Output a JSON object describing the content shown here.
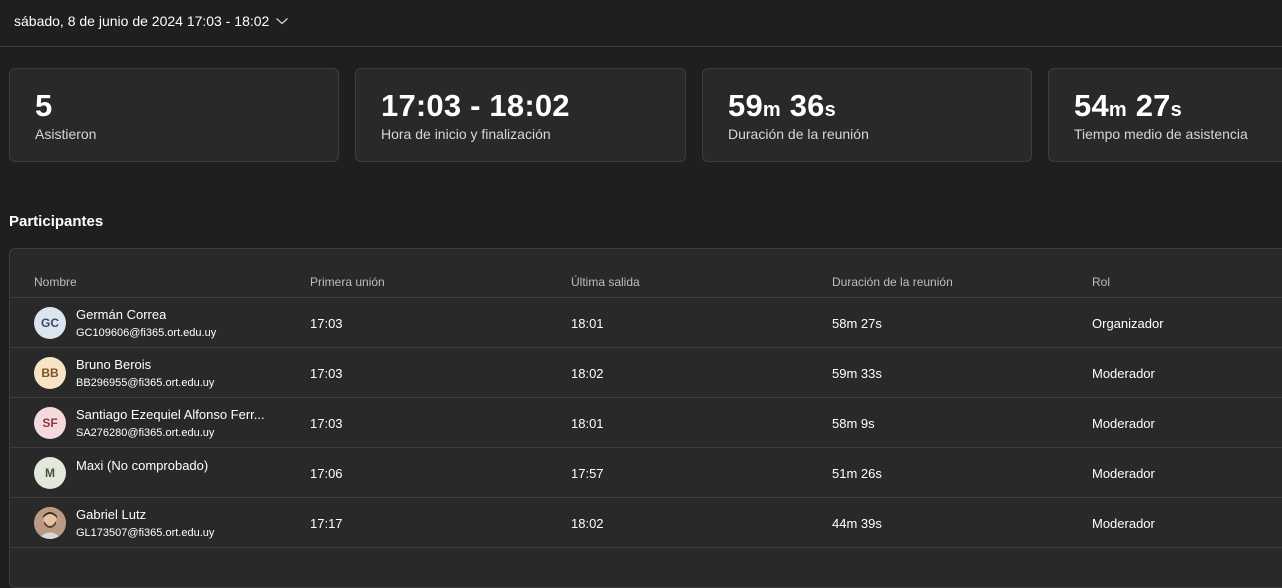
{
  "header": {
    "date_range": "sábado, 8 de junio de 2024 17:03 - 18:02"
  },
  "stats": [
    {
      "value_parts": [
        {
          "num": "5"
        }
      ],
      "label": "Asistieron"
    },
    {
      "value_parts": [
        {
          "num": "17:03 - 18:02"
        }
      ],
      "label": "Hora de inicio y finalización"
    },
    {
      "value_parts": [
        {
          "num": "59",
          "unit": "m"
        },
        {
          "num": " 36",
          "unit": "s"
        }
      ],
      "label": "Duración de la reunión"
    },
    {
      "value_parts": [
        {
          "num": "54",
          "unit": "m"
        },
        {
          "num": " 27",
          "unit": "s"
        }
      ],
      "label": "Tiempo medio de asistencia"
    }
  ],
  "participants": {
    "title": "Participantes",
    "columns": [
      "Nombre",
      "Primera unión",
      "Última salida",
      "Duración de la reunión",
      "Rol"
    ],
    "rows": [
      {
        "initials": "GC",
        "avatar_bg": "#dce4ef",
        "avatar_fg": "#3b4c66",
        "name": "Germán Correa",
        "email": "GC109606@fi365.ort.edu.uy",
        "first_join": "17:03",
        "last_leave": "18:01",
        "duration": "58m 27s",
        "role": "Organizador"
      },
      {
        "initials": "BB",
        "avatar_bg": "#f7e3c6",
        "avatar_fg": "#7a5526",
        "name": "Bruno Berois",
        "email": "BB296955@fi365.ort.edu.uy",
        "first_join": "17:03",
        "last_leave": "18:02",
        "duration": "59m 33s",
        "role": "Moderador"
      },
      {
        "initials": "SF",
        "avatar_bg": "#f6d9dc",
        "avatar_fg": "#8a3a44",
        "name": "Santiago Ezequiel Alfonso Ferr...",
        "email": "SA276280@fi365.ort.edu.uy",
        "first_join": "17:03",
        "last_leave": "18:01",
        "duration": "58m 9s",
        "role": "Moderador"
      },
      {
        "initials": "M",
        "avatar_bg": "#e2e8dc",
        "avatar_fg": "#45523b",
        "name": "Maxi (No comprobado)",
        "email": "",
        "first_join": "17:06",
        "last_leave": "17:57",
        "duration": "51m 26s",
        "role": "Moderador"
      },
      {
        "initials": "",
        "photo": true,
        "avatar_bg": "#8a6a55",
        "avatar_fg": "#ffffff",
        "name": "Gabriel Lutz",
        "email": "GL173507@fi365.ort.edu.uy",
        "first_join": "17:17",
        "last_leave": "18:02",
        "duration": "44m 39s",
        "role": "Moderador"
      }
    ]
  }
}
